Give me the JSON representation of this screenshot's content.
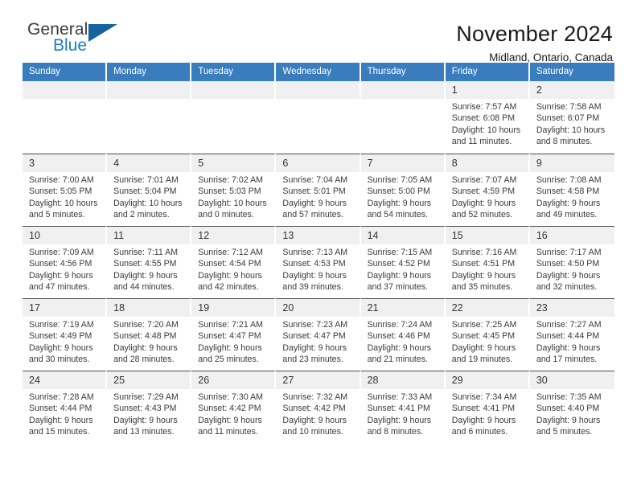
{
  "brand": {
    "name_part1": "General",
    "name_part2": "Blue",
    "triangle_icon": "triangle-icon",
    "color_primary": "#1d7dc4",
    "color_dark": "#3b3b3b"
  },
  "header": {
    "title": "November 2024",
    "subtitle": "Midland, Ontario, Canada"
  },
  "theme": {
    "header_row_bg": "#3a7dbf",
    "day_number_bg": "#f0f0f0",
    "text": "#3a3a3a"
  },
  "weekdays": [
    {
      "label": "Sunday"
    },
    {
      "label": "Monday"
    },
    {
      "label": "Tuesday"
    },
    {
      "label": "Wednesday"
    },
    {
      "label": "Thursday"
    },
    {
      "label": "Friday"
    },
    {
      "label": "Saturday"
    }
  ],
  "weeks": [
    [
      {
        "day": "",
        "empty": true,
        "sunrise": "",
        "sunset": "",
        "daylight_line1": "",
        "daylight_line2": ""
      },
      {
        "day": "",
        "empty": true,
        "sunrise": "",
        "sunset": "",
        "daylight_line1": "",
        "daylight_line2": ""
      },
      {
        "day": "",
        "empty": true,
        "sunrise": "",
        "sunset": "",
        "daylight_line1": "",
        "daylight_line2": ""
      },
      {
        "day": "",
        "empty": true,
        "sunrise": "",
        "sunset": "",
        "daylight_line1": "",
        "daylight_line2": ""
      },
      {
        "day": "",
        "empty": true,
        "sunrise": "",
        "sunset": "",
        "daylight_line1": "",
        "daylight_line2": ""
      },
      {
        "day": "1",
        "sunrise": "Sunrise: 7:57 AM",
        "sunset": "Sunset: 6:08 PM",
        "daylight_line1": "Daylight: 10 hours",
        "daylight_line2": "and 11 minutes."
      },
      {
        "day": "2",
        "sunrise": "Sunrise: 7:58 AM",
        "sunset": "Sunset: 6:07 PM",
        "daylight_line1": "Daylight: 10 hours",
        "daylight_line2": "and 8 minutes."
      }
    ],
    [
      {
        "day": "3",
        "sunrise": "Sunrise: 7:00 AM",
        "sunset": "Sunset: 5:05 PM",
        "daylight_line1": "Daylight: 10 hours",
        "daylight_line2": "and 5 minutes."
      },
      {
        "day": "4",
        "sunrise": "Sunrise: 7:01 AM",
        "sunset": "Sunset: 5:04 PM",
        "daylight_line1": "Daylight: 10 hours",
        "daylight_line2": "and 2 minutes."
      },
      {
        "day": "5",
        "sunrise": "Sunrise: 7:02 AM",
        "sunset": "Sunset: 5:03 PM",
        "daylight_line1": "Daylight: 10 hours",
        "daylight_line2": "and 0 minutes."
      },
      {
        "day": "6",
        "sunrise": "Sunrise: 7:04 AM",
        "sunset": "Sunset: 5:01 PM",
        "daylight_line1": "Daylight: 9 hours",
        "daylight_line2": "and 57 minutes."
      },
      {
        "day": "7",
        "sunrise": "Sunrise: 7:05 AM",
        "sunset": "Sunset: 5:00 PM",
        "daylight_line1": "Daylight: 9 hours",
        "daylight_line2": "and 54 minutes."
      },
      {
        "day": "8",
        "sunrise": "Sunrise: 7:07 AM",
        "sunset": "Sunset: 4:59 PM",
        "daylight_line1": "Daylight: 9 hours",
        "daylight_line2": "and 52 minutes."
      },
      {
        "day": "9",
        "sunrise": "Sunrise: 7:08 AM",
        "sunset": "Sunset: 4:58 PM",
        "daylight_line1": "Daylight: 9 hours",
        "daylight_line2": "and 49 minutes."
      }
    ],
    [
      {
        "day": "10",
        "sunrise": "Sunrise: 7:09 AM",
        "sunset": "Sunset: 4:56 PM",
        "daylight_line1": "Daylight: 9 hours",
        "daylight_line2": "and 47 minutes."
      },
      {
        "day": "11",
        "sunrise": "Sunrise: 7:11 AM",
        "sunset": "Sunset: 4:55 PM",
        "daylight_line1": "Daylight: 9 hours",
        "daylight_line2": "and 44 minutes."
      },
      {
        "day": "12",
        "sunrise": "Sunrise: 7:12 AM",
        "sunset": "Sunset: 4:54 PM",
        "daylight_line1": "Daylight: 9 hours",
        "daylight_line2": "and 42 minutes."
      },
      {
        "day": "13",
        "sunrise": "Sunrise: 7:13 AM",
        "sunset": "Sunset: 4:53 PM",
        "daylight_line1": "Daylight: 9 hours",
        "daylight_line2": "and 39 minutes."
      },
      {
        "day": "14",
        "sunrise": "Sunrise: 7:15 AM",
        "sunset": "Sunset: 4:52 PM",
        "daylight_line1": "Daylight: 9 hours",
        "daylight_line2": "and 37 minutes."
      },
      {
        "day": "15",
        "sunrise": "Sunrise: 7:16 AM",
        "sunset": "Sunset: 4:51 PM",
        "daylight_line1": "Daylight: 9 hours",
        "daylight_line2": "and 35 minutes."
      },
      {
        "day": "16",
        "sunrise": "Sunrise: 7:17 AM",
        "sunset": "Sunset: 4:50 PM",
        "daylight_line1": "Daylight: 9 hours",
        "daylight_line2": "and 32 minutes."
      }
    ],
    [
      {
        "day": "17",
        "sunrise": "Sunrise: 7:19 AM",
        "sunset": "Sunset: 4:49 PM",
        "daylight_line1": "Daylight: 9 hours",
        "daylight_line2": "and 30 minutes."
      },
      {
        "day": "18",
        "sunrise": "Sunrise: 7:20 AM",
        "sunset": "Sunset: 4:48 PM",
        "daylight_line1": "Daylight: 9 hours",
        "daylight_line2": "and 28 minutes."
      },
      {
        "day": "19",
        "sunrise": "Sunrise: 7:21 AM",
        "sunset": "Sunset: 4:47 PM",
        "daylight_line1": "Daylight: 9 hours",
        "daylight_line2": "and 25 minutes."
      },
      {
        "day": "20",
        "sunrise": "Sunrise: 7:23 AM",
        "sunset": "Sunset: 4:47 PM",
        "daylight_line1": "Daylight: 9 hours",
        "daylight_line2": "and 23 minutes."
      },
      {
        "day": "21",
        "sunrise": "Sunrise: 7:24 AM",
        "sunset": "Sunset: 4:46 PM",
        "daylight_line1": "Daylight: 9 hours",
        "daylight_line2": "and 21 minutes."
      },
      {
        "day": "22",
        "sunrise": "Sunrise: 7:25 AM",
        "sunset": "Sunset: 4:45 PM",
        "daylight_line1": "Daylight: 9 hours",
        "daylight_line2": "and 19 minutes."
      },
      {
        "day": "23",
        "sunrise": "Sunrise: 7:27 AM",
        "sunset": "Sunset: 4:44 PM",
        "daylight_line1": "Daylight: 9 hours",
        "daylight_line2": "and 17 minutes."
      }
    ],
    [
      {
        "day": "24",
        "sunrise": "Sunrise: 7:28 AM",
        "sunset": "Sunset: 4:44 PM",
        "daylight_line1": "Daylight: 9 hours",
        "daylight_line2": "and 15 minutes."
      },
      {
        "day": "25",
        "sunrise": "Sunrise: 7:29 AM",
        "sunset": "Sunset: 4:43 PM",
        "daylight_line1": "Daylight: 9 hours",
        "daylight_line2": "and 13 minutes."
      },
      {
        "day": "26",
        "sunrise": "Sunrise: 7:30 AM",
        "sunset": "Sunset: 4:42 PM",
        "daylight_line1": "Daylight: 9 hours",
        "daylight_line2": "and 11 minutes."
      },
      {
        "day": "27",
        "sunrise": "Sunrise: 7:32 AM",
        "sunset": "Sunset: 4:42 PM",
        "daylight_line1": "Daylight: 9 hours",
        "daylight_line2": "and 10 minutes."
      },
      {
        "day": "28",
        "sunrise": "Sunrise: 7:33 AM",
        "sunset": "Sunset: 4:41 PM",
        "daylight_line1": "Daylight: 9 hours",
        "daylight_line2": "and 8 minutes."
      },
      {
        "day": "29",
        "sunrise": "Sunrise: 7:34 AM",
        "sunset": "Sunset: 4:41 PM",
        "daylight_line1": "Daylight: 9 hours",
        "daylight_line2": "and 6 minutes."
      },
      {
        "day": "30",
        "sunrise": "Sunrise: 7:35 AM",
        "sunset": "Sunset: 4:40 PM",
        "daylight_line1": "Daylight: 9 hours",
        "daylight_line2": "and 5 minutes."
      }
    ]
  ]
}
